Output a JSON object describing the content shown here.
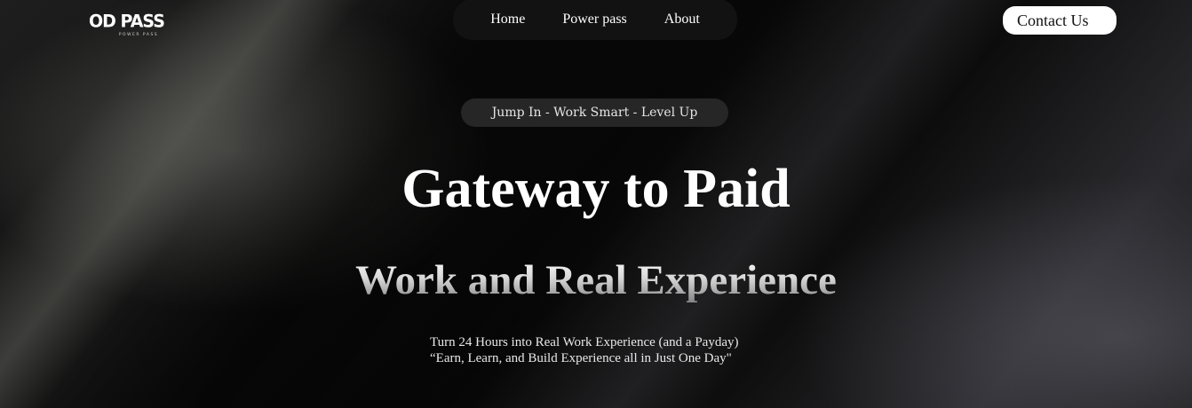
{
  "brand": {
    "logo_text": "OD PASS",
    "logo_subtext": "POWER PASS"
  },
  "nav": {
    "items": [
      {
        "label": "Home"
      },
      {
        "label": "Power pass"
      },
      {
        "label": "About"
      }
    ],
    "contact_label": "Contact Us"
  },
  "hero": {
    "tagline": "Jump In - Work Smart - Level Up",
    "title_line1": "Gateway to Paid",
    "title_line2": "Work and Real Experience",
    "subtitle_line1": "Turn 24 Hours into Real Work Experience (and a Payday)",
    "subtitle_line2": "“Earn, Learn, and Build Experience all in Just One Day\""
  },
  "colors": {
    "background": "#0a0a0a",
    "nav_bg": "#121212",
    "pill_bg": "#262626",
    "button_bg": "#ffffff",
    "button_text": "#111111"
  }
}
